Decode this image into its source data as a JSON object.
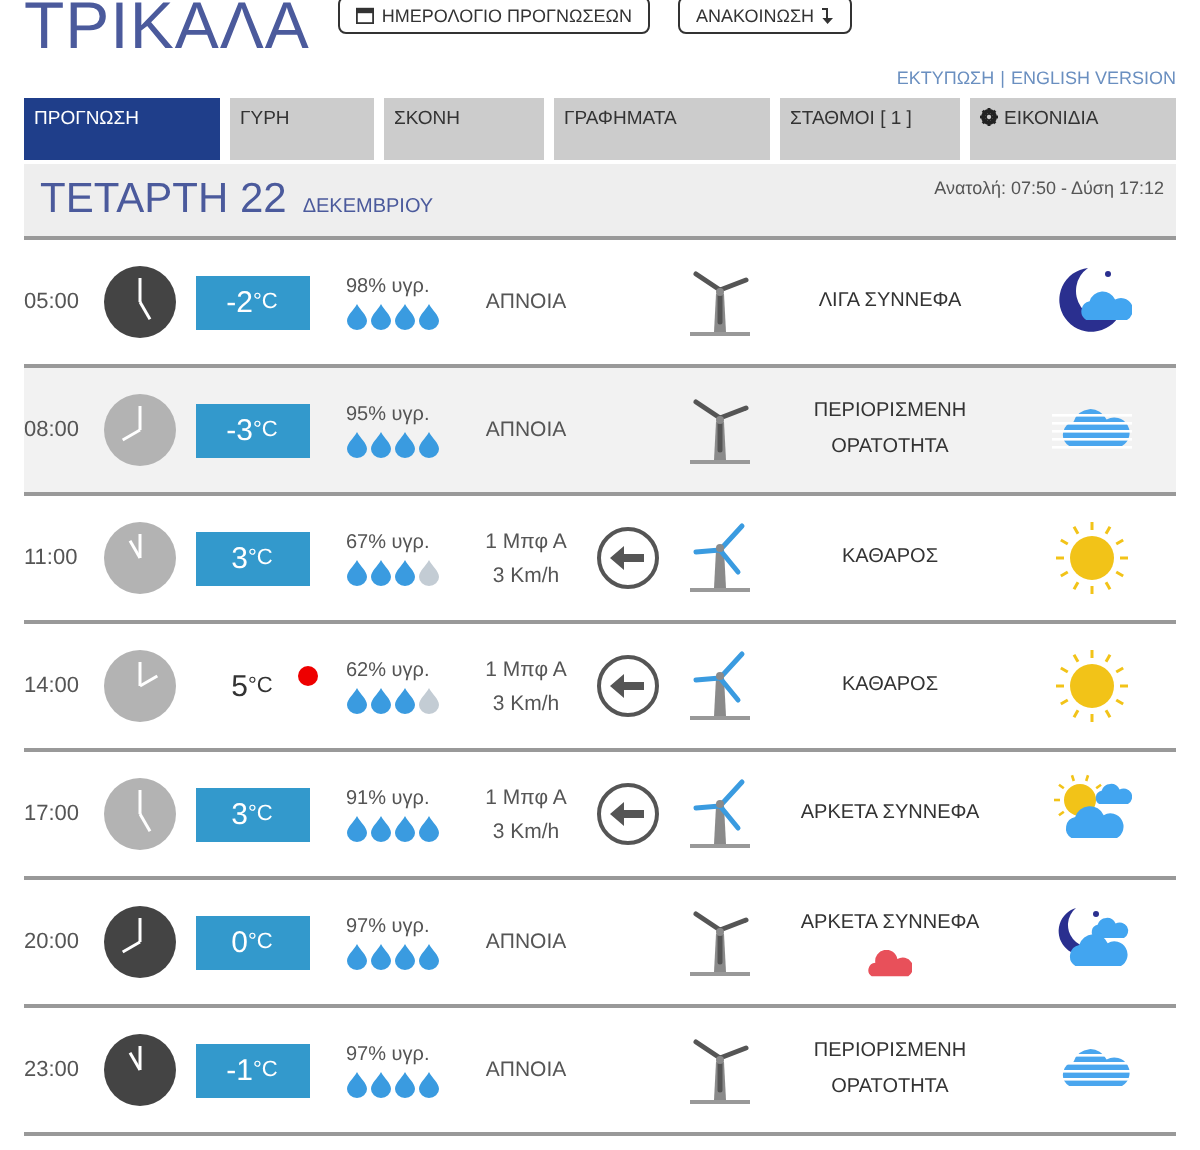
{
  "city": "ΤΡΙΚΑΛΑ",
  "header_buttons": [
    {
      "label": "ΗΜΕΡΟΛΟΓΙΟ ΠΡΟΓΝΩΣΕΩΝ",
      "kind": "calendar"
    },
    {
      "label": "ΑΝΑΚΟΙΝΩΣΗ",
      "kind": "notice"
    }
  ],
  "links": [
    "ΕΚΤΥΠΩΣΗ",
    "|",
    "ENGLISH VERSION"
  ],
  "tabs": [
    {
      "label": "ΠΡΟΓΝΩΣΗ",
      "selected": true
    },
    {
      "label": "ΓΥΡΗ",
      "selected": false
    },
    {
      "label": "ΣΚΟΝΗ",
      "selected": false
    },
    {
      "label": "ΓΡΑΦΗΜΑΤΑ",
      "selected": false
    },
    {
      "label": "ΣΤΑΘΜΟΙ  [ 1 ]",
      "selected": false
    },
    {
      "label": "ΕΙΚΟΝΙΔΙΑ",
      "selected": false,
      "kind": "settings"
    }
  ],
  "day": {
    "weekday": "ΤΕΤΑΡΤΗ 22",
    "month": "ΔΕΚΕΜΒΡΙΟΥ",
    "sun": "Ανατολή: 07:50  - Δύση 17:12"
  },
  "rows": [
    {
      "time": "05:00",
      "night": true,
      "temp": "-2",
      "unit": "°C",
      "boxed": true,
      "alert": false,
      "humidity": "98% υγρ.",
      "stars": 4,
      "calm": true,
      "wind": [
        "ΑΠΝΟΙΑ"
      ],
      "condition": "ΛΙΓΑ ΣΥΝΝΕΦΑ",
      "kind": "moon-cloud",
      "highlighted": false,
      "rain_warning": false
    },
    {
      "time": "08:00",
      "night": false,
      "temp": "-3",
      "unit": "°C",
      "boxed": true,
      "alert": false,
      "humidity": "95% υγρ.",
      "stars": 4,
      "calm": true,
      "wind": [
        "ΑΠΝΟΙΑ"
      ],
      "condition": "ΠΕΡΙΟΡΙΣΜΕΝΗ ΟΡΑΤΟΤΗΤΑ",
      "kind": "fog",
      "highlighted": true,
      "rain_warning": false
    },
    {
      "time": "11:00",
      "night": false,
      "temp": "3",
      "unit": "°C",
      "boxed": true,
      "alert": false,
      "humidity": "67% υγρ.",
      "stars": 3,
      "calm": false,
      "wind": [
        "1 Μπφ Α",
        "3 Km/h"
      ],
      "condition": "ΚΑΘΑΡΟΣ",
      "kind": "sun",
      "highlighted": false,
      "rain_warning": false
    },
    {
      "time": "14:00",
      "night": false,
      "temp": "5",
      "unit": "°C",
      "boxed": false,
      "alert": true,
      "humidity": "62% υγρ.",
      "stars": 3,
      "calm": false,
      "wind": [
        "1 Μπφ Α",
        "3 Km/h"
      ],
      "condition": "ΚΑΘΑΡΟΣ",
      "kind": "sun",
      "highlighted": false,
      "rain_warning": false
    },
    {
      "time": "17:00",
      "night": false,
      "temp": "3",
      "unit": "°C",
      "boxed": true,
      "alert": false,
      "humidity": "91% υγρ.",
      "stars": 4,
      "calm": false,
      "wind": [
        "1 Μπφ Α",
        "3 Km/h"
      ],
      "condition": "ΑΡΚΕΤΑ ΣΥΝΝΕΦΑ",
      "kind": "sun-cloud",
      "highlighted": false,
      "rain_warning": false
    },
    {
      "time": "20:00",
      "night": true,
      "temp": "0",
      "unit": "°C",
      "boxed": true,
      "alert": false,
      "humidity": "97% υγρ.",
      "stars": 4,
      "calm": true,
      "wind": [
        "ΑΠΝΟΙΑ"
      ],
      "condition": "ΑΡΚΕΤΑ ΣΥΝΝΕΦΑ",
      "kind": "moon-clouds",
      "highlighted": false,
      "rain_warning": true
    },
    {
      "time": "23:00",
      "night": true,
      "temp": "-1",
      "unit": "°C",
      "boxed": true,
      "alert": false,
      "humidity": "97% υγρ.",
      "stars": 4,
      "calm": true,
      "wind": [
        "ΑΠΝΟΙΑ"
      ],
      "condition": "ΠΕΡΙΟΡΙΣΜΕΝΗ ΟΡΑΤΟΤΗΤΑ",
      "kind": "fog",
      "highlighted": false,
      "rain_warning": false
    }
  ]
}
